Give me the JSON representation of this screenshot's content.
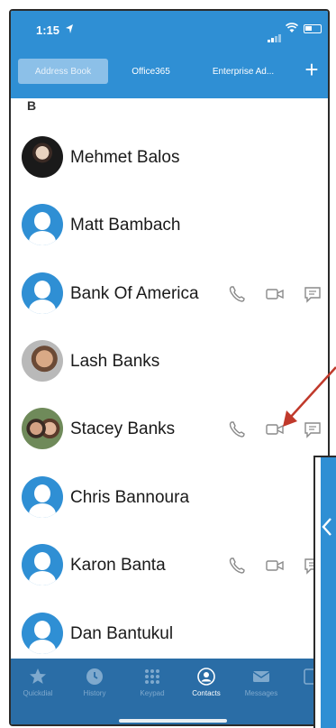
{
  "status_bar": {
    "time": "1:15"
  },
  "tabs": [
    {
      "label": "Address Book",
      "active": true
    },
    {
      "label": "Office365",
      "active": false
    },
    {
      "label": "Enterprise Ad...",
      "active": false
    }
  ],
  "add_label": "+",
  "section_letter": "B",
  "contacts": [
    {
      "name": "Mehmet Balos",
      "avatar": "photo",
      "actions": false
    },
    {
      "name": "Matt Bambach",
      "avatar": "generic",
      "actions": false
    },
    {
      "name": "Bank Of America",
      "avatar": "generic",
      "actions": true
    },
    {
      "name": "Lash Banks",
      "avatar": "photo",
      "actions": false
    },
    {
      "name": "Stacey Banks",
      "avatar": "photo",
      "actions": true
    },
    {
      "name": "Chris Bannoura",
      "avatar": "generic",
      "actions": false
    },
    {
      "name": "Karon Banta",
      "avatar": "generic",
      "actions": true
    },
    {
      "name": "Dan Bantukul",
      "avatar": "generic",
      "actions": false
    }
  ],
  "bottom_tabs": [
    {
      "label": "Quickdial",
      "icon": "star-icon",
      "active": false
    },
    {
      "label": "History",
      "icon": "clock-icon",
      "active": false
    },
    {
      "label": "Keypad",
      "icon": "keypad-icon",
      "active": false
    },
    {
      "label": "Contacts",
      "icon": "contacts-icon",
      "active": true
    },
    {
      "label": "Messages",
      "icon": "messages-icon",
      "active": false
    }
  ],
  "colors": {
    "header_blue": "#2f8fd4",
    "tabbar_blue": "#2a6da6",
    "annotation_arrow": "#c0392b"
  }
}
